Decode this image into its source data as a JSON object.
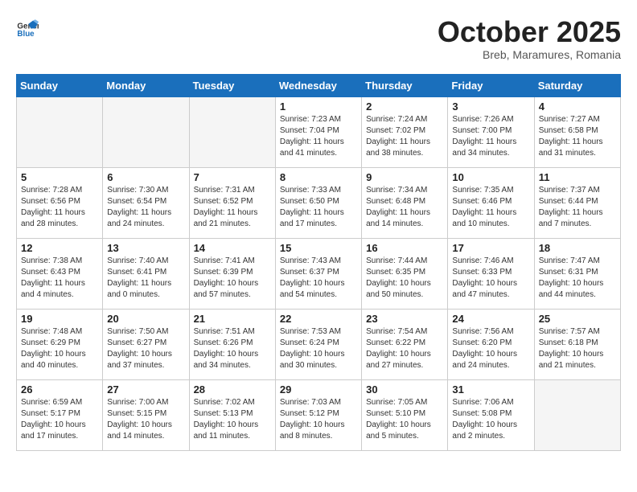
{
  "header": {
    "logo_general": "General",
    "logo_blue": "Blue",
    "month_title": "October 2025",
    "subtitle": "Breb, Maramures, Romania"
  },
  "weekdays": [
    "Sunday",
    "Monday",
    "Tuesday",
    "Wednesday",
    "Thursday",
    "Friday",
    "Saturday"
  ],
  "weeks": [
    [
      {
        "day": "",
        "info": ""
      },
      {
        "day": "",
        "info": ""
      },
      {
        "day": "",
        "info": ""
      },
      {
        "day": "1",
        "info": "Sunrise: 7:23 AM\nSunset: 7:04 PM\nDaylight: 11 hours\nand 41 minutes."
      },
      {
        "day": "2",
        "info": "Sunrise: 7:24 AM\nSunset: 7:02 PM\nDaylight: 11 hours\nand 38 minutes."
      },
      {
        "day": "3",
        "info": "Sunrise: 7:26 AM\nSunset: 7:00 PM\nDaylight: 11 hours\nand 34 minutes."
      },
      {
        "day": "4",
        "info": "Sunrise: 7:27 AM\nSunset: 6:58 PM\nDaylight: 11 hours\nand 31 minutes."
      }
    ],
    [
      {
        "day": "5",
        "info": "Sunrise: 7:28 AM\nSunset: 6:56 PM\nDaylight: 11 hours\nand 28 minutes."
      },
      {
        "day": "6",
        "info": "Sunrise: 7:30 AM\nSunset: 6:54 PM\nDaylight: 11 hours\nand 24 minutes."
      },
      {
        "day": "7",
        "info": "Sunrise: 7:31 AM\nSunset: 6:52 PM\nDaylight: 11 hours\nand 21 minutes."
      },
      {
        "day": "8",
        "info": "Sunrise: 7:33 AM\nSunset: 6:50 PM\nDaylight: 11 hours\nand 17 minutes."
      },
      {
        "day": "9",
        "info": "Sunrise: 7:34 AM\nSunset: 6:48 PM\nDaylight: 11 hours\nand 14 minutes."
      },
      {
        "day": "10",
        "info": "Sunrise: 7:35 AM\nSunset: 6:46 PM\nDaylight: 11 hours\nand 10 minutes."
      },
      {
        "day": "11",
        "info": "Sunrise: 7:37 AM\nSunset: 6:44 PM\nDaylight: 11 hours\nand 7 minutes."
      }
    ],
    [
      {
        "day": "12",
        "info": "Sunrise: 7:38 AM\nSunset: 6:43 PM\nDaylight: 11 hours\nand 4 minutes."
      },
      {
        "day": "13",
        "info": "Sunrise: 7:40 AM\nSunset: 6:41 PM\nDaylight: 11 hours\nand 0 minutes."
      },
      {
        "day": "14",
        "info": "Sunrise: 7:41 AM\nSunset: 6:39 PM\nDaylight: 10 hours\nand 57 minutes."
      },
      {
        "day": "15",
        "info": "Sunrise: 7:43 AM\nSunset: 6:37 PM\nDaylight: 10 hours\nand 54 minutes."
      },
      {
        "day": "16",
        "info": "Sunrise: 7:44 AM\nSunset: 6:35 PM\nDaylight: 10 hours\nand 50 minutes."
      },
      {
        "day": "17",
        "info": "Sunrise: 7:46 AM\nSunset: 6:33 PM\nDaylight: 10 hours\nand 47 minutes."
      },
      {
        "day": "18",
        "info": "Sunrise: 7:47 AM\nSunset: 6:31 PM\nDaylight: 10 hours\nand 44 minutes."
      }
    ],
    [
      {
        "day": "19",
        "info": "Sunrise: 7:48 AM\nSunset: 6:29 PM\nDaylight: 10 hours\nand 40 minutes."
      },
      {
        "day": "20",
        "info": "Sunrise: 7:50 AM\nSunset: 6:27 PM\nDaylight: 10 hours\nand 37 minutes."
      },
      {
        "day": "21",
        "info": "Sunrise: 7:51 AM\nSunset: 6:26 PM\nDaylight: 10 hours\nand 34 minutes."
      },
      {
        "day": "22",
        "info": "Sunrise: 7:53 AM\nSunset: 6:24 PM\nDaylight: 10 hours\nand 30 minutes."
      },
      {
        "day": "23",
        "info": "Sunrise: 7:54 AM\nSunset: 6:22 PM\nDaylight: 10 hours\nand 27 minutes."
      },
      {
        "day": "24",
        "info": "Sunrise: 7:56 AM\nSunset: 6:20 PM\nDaylight: 10 hours\nand 24 minutes."
      },
      {
        "day": "25",
        "info": "Sunrise: 7:57 AM\nSunset: 6:18 PM\nDaylight: 10 hours\nand 21 minutes."
      }
    ],
    [
      {
        "day": "26",
        "info": "Sunrise: 6:59 AM\nSunset: 5:17 PM\nDaylight: 10 hours\nand 17 minutes."
      },
      {
        "day": "27",
        "info": "Sunrise: 7:00 AM\nSunset: 5:15 PM\nDaylight: 10 hours\nand 14 minutes."
      },
      {
        "day": "28",
        "info": "Sunrise: 7:02 AM\nSunset: 5:13 PM\nDaylight: 10 hours\nand 11 minutes."
      },
      {
        "day": "29",
        "info": "Sunrise: 7:03 AM\nSunset: 5:12 PM\nDaylight: 10 hours\nand 8 minutes."
      },
      {
        "day": "30",
        "info": "Sunrise: 7:05 AM\nSunset: 5:10 PM\nDaylight: 10 hours\nand 5 minutes."
      },
      {
        "day": "31",
        "info": "Sunrise: 7:06 AM\nSunset: 5:08 PM\nDaylight: 10 hours\nand 2 minutes."
      },
      {
        "day": "",
        "info": ""
      }
    ]
  ]
}
